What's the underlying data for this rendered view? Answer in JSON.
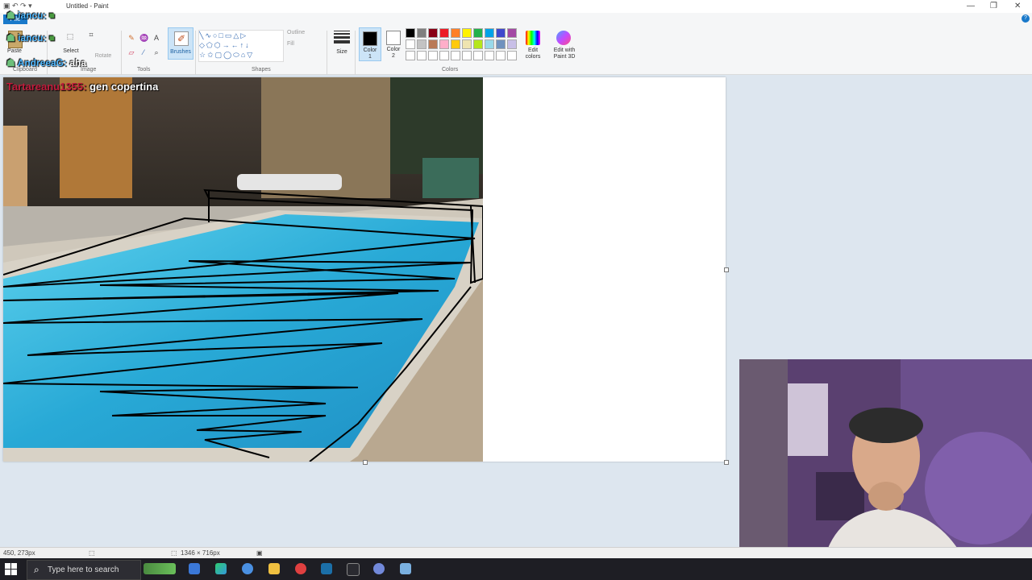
{
  "window": {
    "title": "Untitled - Paint"
  },
  "ribbon": {
    "file_tab": "File",
    "clipboard": {
      "paste": "Paste",
      "group": "Clipboard"
    },
    "image": {
      "select": "Select",
      "rotate": "Rotate",
      "group": "Image"
    },
    "tools": {
      "group": "Tools"
    },
    "brushes": {
      "label": "Brushes"
    },
    "shapes": {
      "outline": "Outline",
      "fill": "Fill",
      "group": "Shapes"
    },
    "size": {
      "label": "Size"
    },
    "colors": {
      "color1_line1": "Color",
      "color1_line2": "1",
      "color2_line1": "Color",
      "color2_line2": "2",
      "edit_line1": "Edit",
      "edit_line2": "colors",
      "paint3d_line1": "Edit with",
      "paint3d_line2": "Paint 3D",
      "group": "Colors",
      "color1": "#000000",
      "color2": "#ffffff",
      "palette": [
        "#000000",
        "#7f7f7f",
        "#880015",
        "#ed1c24",
        "#ff7f27",
        "#fff200",
        "#22b14c",
        "#00a2e8",
        "#3f48cc",
        "#a349a4",
        "#ffffff",
        "#c3c3c3",
        "#b97a57",
        "#ffaec9",
        "#ffc90e",
        "#efe4b0",
        "#b5e61d",
        "#99d9ea",
        "#7092be",
        "#c8bfe7",
        "#ffffff",
        "#ffffff",
        "#ffffff",
        "#ffffff",
        "#ffffff",
        "#ffffff",
        "#ffffff",
        "#ffffff",
        "#ffffff",
        "#ffffff"
      ]
    }
  },
  "chat": [
    {
      "user": "iancu:",
      "message": ""
    },
    {
      "user": "iancu:",
      "message": ""
    },
    {
      "user": "AndreeaG:",
      "message": "aha"
    },
    {
      "user": "Tartareanu1355:",
      "message": "gen copertina"
    }
  ],
  "status": {
    "cursor": "450, 273px",
    "canvas_size": "1346 × 716px"
  },
  "taskbar": {
    "search_placeholder": "Type here to search"
  }
}
